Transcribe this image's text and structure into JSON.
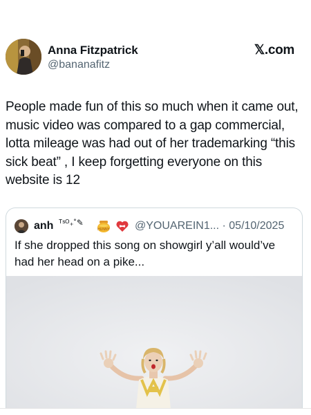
{
  "tweet": {
    "author_name": "Anna Fitzpatrick",
    "author_handle": "@bananafitz",
    "brand": "𝕏.com",
    "text": "People made fun of this so much when it came out, music video was compared to a gap commercial,  lotta mileage was had out of her trademarking “this sick beat” , I keep forgetting everyone on this website is 12"
  },
  "quote": {
    "author_name": "anh",
    "author_name_decoration": "ᵀˢᴼ₊˚✎",
    "handle_and_date": "@YOUAREIN1... · 05/10/2025",
    "text": "If she dropped this song on showgirl y’all would’ve had her head on a pike...",
    "emoji_icons": [
      "honey-pot-icon",
      "mending-heart-icon"
    ]
  },
  "colors": {
    "text_primary": "#0f1419",
    "text_secondary": "#536471",
    "border": "#cfd9de",
    "media_background": "#e8e9ec",
    "outfit_gold": "#e3c24a"
  }
}
